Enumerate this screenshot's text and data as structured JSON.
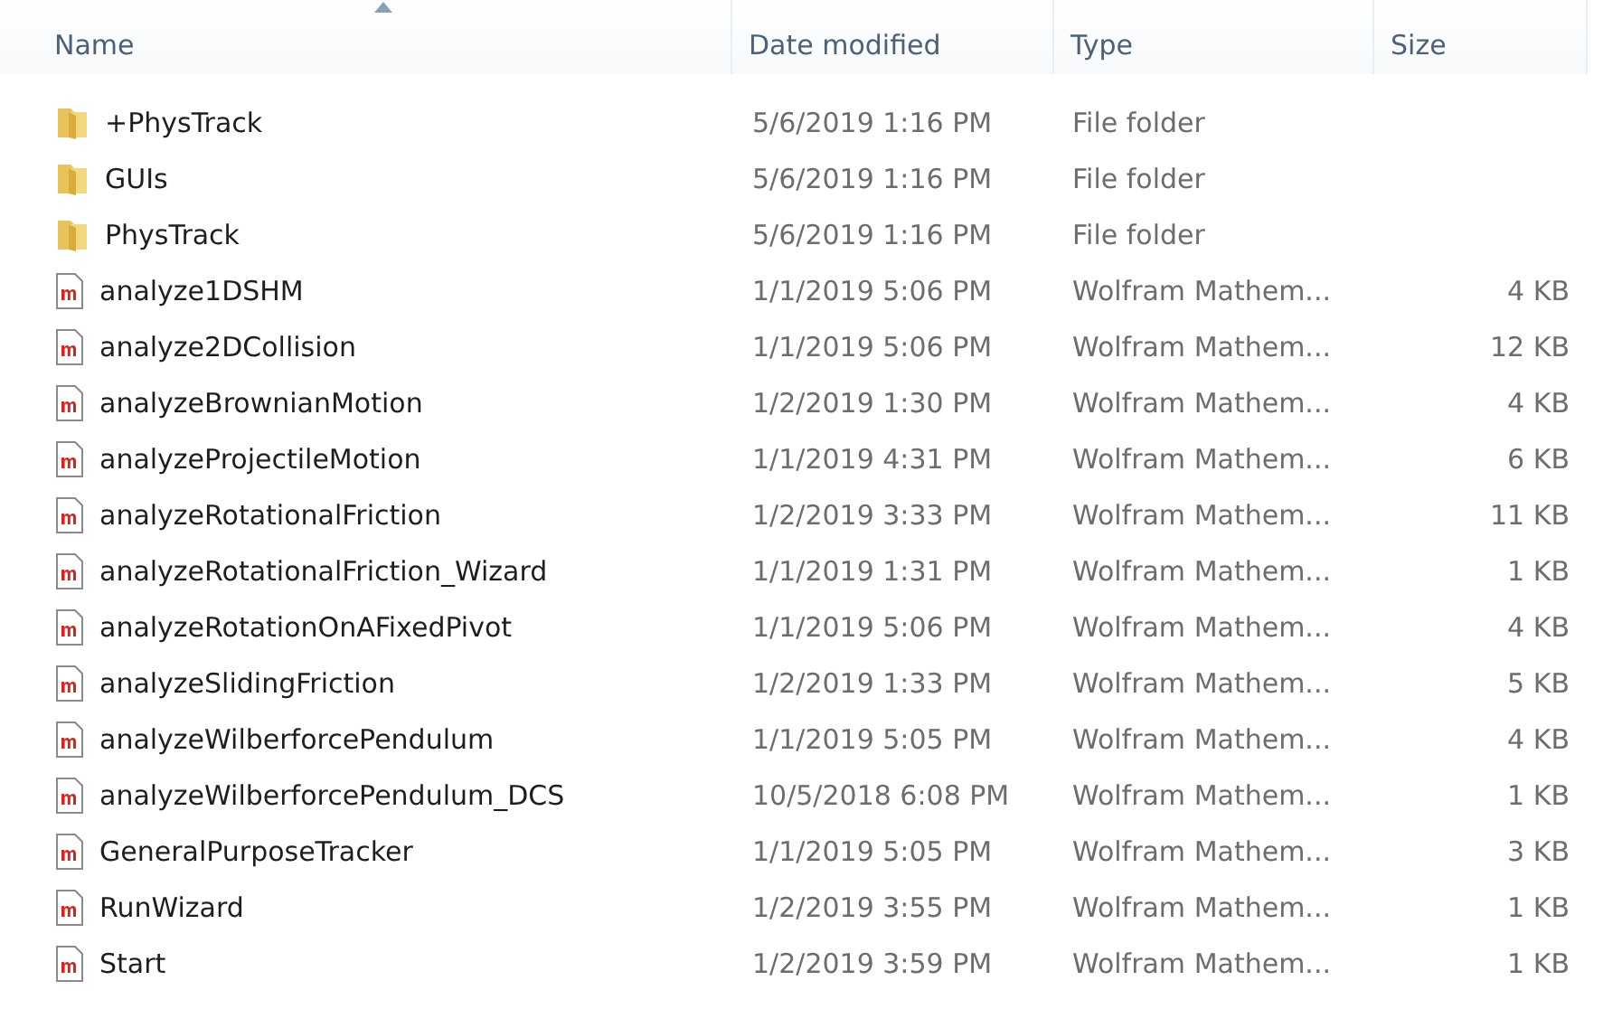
{
  "columns": [
    {
      "label": "Name",
      "sorted": true
    },
    {
      "label": "Date modified",
      "sorted": false
    },
    {
      "label": "Type",
      "sorted": false
    },
    {
      "label": "Size",
      "sorted": false
    }
  ],
  "rows": [
    {
      "kind": "folder",
      "name": "+PhysTrack",
      "date": "5/6/2019 1:16 PM",
      "type": "File folder"
    },
    {
      "kind": "folder",
      "name": "GUIs",
      "date": "5/6/2019 1:16 PM",
      "type": "File folder"
    },
    {
      "kind": "folder",
      "name": "PhysTrack",
      "date": "5/6/2019 1:16 PM",
      "type": "File folder"
    },
    {
      "kind": "m-file",
      "name": "analyze1DSHM",
      "date": "1/1/2019 5:06 PM",
      "type": "Wolfram Mathem...",
      "size": "4 KB"
    },
    {
      "kind": "m-file",
      "name": "analyze2DCollision",
      "date": "1/1/2019 5:06 PM",
      "type": "Wolfram Mathem...",
      "size": "12 KB"
    },
    {
      "kind": "m-file",
      "name": "analyzeBrownianMotion",
      "date": "1/2/2019 1:30 PM",
      "type": "Wolfram Mathem...",
      "size": "4 KB"
    },
    {
      "kind": "m-file",
      "name": "analyzeProjectileMotion",
      "date": "1/1/2019 4:31 PM",
      "type": "Wolfram Mathem...",
      "size": "6 KB"
    },
    {
      "kind": "m-file",
      "name": "analyzeRotationalFriction",
      "date": "1/2/2019 3:33 PM",
      "type": "Wolfram Mathem...",
      "size": "11 KB"
    },
    {
      "kind": "m-file",
      "name": "analyzeRotationalFriction_Wizard",
      "date": "1/1/2019 1:31 PM",
      "type": "Wolfram Mathem...",
      "size": "1 KB"
    },
    {
      "kind": "m-file",
      "name": "analyzeRotationOnAFixedPivot",
      "date": "1/1/2019 5:06 PM",
      "type": "Wolfram Mathem...",
      "size": "4 KB"
    },
    {
      "kind": "m-file",
      "name": "analyzeSlidingFriction",
      "date": "1/2/2019 1:33 PM",
      "type": "Wolfram Mathem...",
      "size": "5 KB"
    },
    {
      "kind": "m-file",
      "name": "analyzeWilberforcePendulum",
      "date": "1/1/2019 5:05 PM",
      "type": "Wolfram Mathem...",
      "size": "4 KB"
    },
    {
      "kind": "m-file",
      "name": "analyzeWilberforcePendulum_DCS",
      "date": "10/5/2018 6:08 PM",
      "type": "Wolfram Mathem...",
      "size": "1 KB"
    },
    {
      "kind": "m-file",
      "name": "GeneralPurposeTracker",
      "date": "1/1/2019 5:05 PM",
      "type": "Wolfram Mathem...",
      "size": "3 KB"
    },
    {
      "kind": "m-file",
      "name": "RunWizard",
      "date": "1/2/2019 3:55 PM",
      "type": "Wolfram Mathem...",
      "size": "1 KB"
    },
    {
      "kind": "m-file",
      "name": "Start",
      "date": "1/2/2019 3:59 PM",
      "type": "Wolfram Mathem...",
      "size": "1 KB"
    }
  ]
}
